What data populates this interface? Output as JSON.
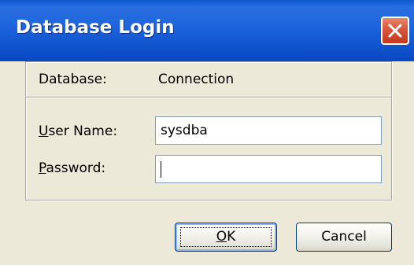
{
  "window": {
    "title": "Database Login"
  },
  "icons": {
    "close": "close-icon"
  },
  "colors": {
    "titlebar": "#0a58d0",
    "close_button": "#d8543a",
    "dialog_background": "#ece9d8"
  },
  "form": {
    "database_label": "Database:",
    "database_value": "Connection",
    "username_label_mnemonic": "U",
    "username_label_rest": "ser Name:",
    "username_value": "sysdba",
    "password_label_mnemonic": "P",
    "password_label_rest": "assword:",
    "password_value": ""
  },
  "buttons": {
    "ok_mnemonic": "O",
    "ok_rest": "K",
    "cancel": "Cancel"
  }
}
